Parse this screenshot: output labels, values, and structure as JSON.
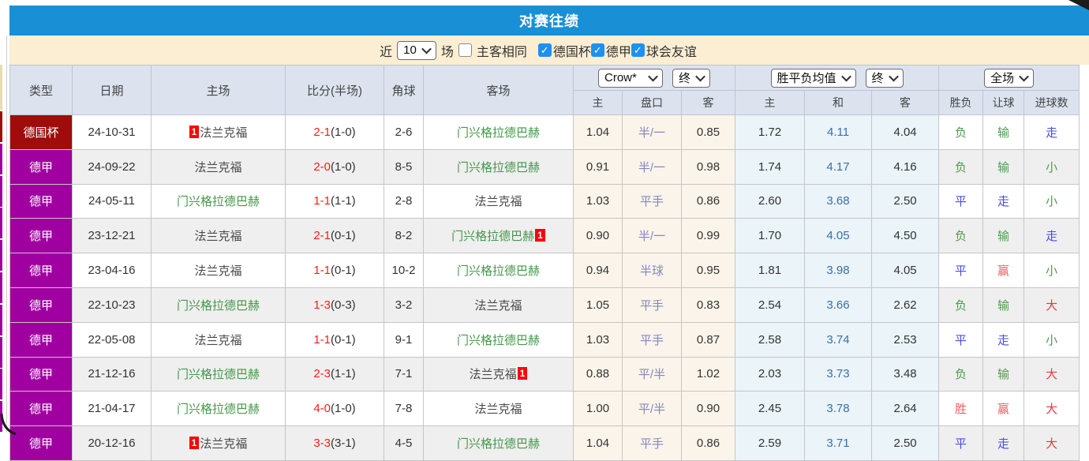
{
  "title": "对赛往绩",
  "filter": {
    "near_label": "近",
    "count_select": "10",
    "games_label": "场",
    "same_venue": {
      "checked": false,
      "label": "主客相同"
    },
    "competitions": [
      {
        "checked": true,
        "label": "德国杯"
      },
      {
        "checked": true,
        "label": "德甲"
      },
      {
        "checked": true,
        "label": "球会友谊"
      }
    ]
  },
  "header": {
    "col_type": "类型",
    "col_date": "日期",
    "col_home": "主场",
    "col_score": "比分(半场)",
    "col_corner": "角球",
    "col_away": "客场",
    "crow_select": "Crow*",
    "crow_final_select": "终",
    "wdl_select": "胜平负均值",
    "wdl_final_select": "终",
    "scope_select": "全场",
    "sub": {
      "home": "主",
      "handicap": "盘口",
      "away": "客",
      "avg_home": "主",
      "avg_draw": "和",
      "avg_away": "客",
      "result": "胜负",
      "handicap_result": "让球",
      "goals": "进球数"
    }
  },
  "colors": {
    "titlebar_blue": "#1990d5",
    "filterbar_cream": "#fbeed3",
    "header_cell": "#dce3ef",
    "cup_red": "#a00c0c",
    "league_purple": "#a100a1",
    "team_green": "#44984a",
    "score_red": "#ff1a1a",
    "handicap_slate": "#8585c6",
    "avg_draw_blue": "#3a6fa8",
    "result_green": "#4e9b4e",
    "result_blue": "#4a4aee",
    "result_red": "#e83a3a",
    "result_pink": "#f26060",
    "red_card_badge": "#ff0000",
    "odds_col_bg": "#faf4ea",
    "avg_col_bg": "#eaf4f9"
  },
  "rows": [
    {
      "type": "德国杯",
      "type_style": "t-cup",
      "date": "24-10-31",
      "home": {
        "name": "法兰克福",
        "green": false,
        "badge": "1",
        "badge_pos": "before"
      },
      "score": "2-1",
      "half": "(1-0)",
      "corner": "2-6",
      "away": {
        "name": "门兴格拉德巴赫",
        "green": true
      },
      "odds": [
        "1.04",
        "半/一",
        "0.85"
      ],
      "avg": [
        "1.72",
        "4.11",
        "4.04"
      ],
      "result": {
        "text": "负",
        "cls": "green"
      },
      "hresult": {
        "text": "输",
        "cls": "green"
      },
      "goals": {
        "text": "走",
        "cls": "blue"
      }
    },
    {
      "type": "德甲",
      "type_style": "t-league",
      "date": "24-09-22",
      "home": {
        "name": "法兰克福",
        "green": false
      },
      "score": "2-0",
      "half": "(1-0)",
      "corner": "8-5",
      "away": {
        "name": "门兴格拉德巴赫",
        "green": true
      },
      "odds": [
        "0.91",
        "半/一",
        "0.98"
      ],
      "avg": [
        "1.74",
        "4.17",
        "4.16"
      ],
      "result": {
        "text": "负",
        "cls": "green"
      },
      "hresult": {
        "text": "输",
        "cls": "green"
      },
      "goals": {
        "text": "小",
        "cls": "green"
      }
    },
    {
      "type": "德甲",
      "type_style": "t-league",
      "date": "24-05-11",
      "home": {
        "name": "门兴格拉德巴赫",
        "green": true
      },
      "score": "1-1",
      "half": "(1-1)",
      "corner": "2-8",
      "away": {
        "name": "法兰克福",
        "green": false
      },
      "odds": [
        "1.03",
        "平手",
        "0.86"
      ],
      "avg": [
        "2.60",
        "3.68",
        "2.50"
      ],
      "result": {
        "text": "平",
        "cls": "blue"
      },
      "hresult": {
        "text": "走",
        "cls": "blue"
      },
      "goals": {
        "text": "小",
        "cls": "green"
      }
    },
    {
      "type": "德甲",
      "type_style": "t-league",
      "date": "23-12-21",
      "home": {
        "name": "法兰克福",
        "green": false
      },
      "score": "2-1",
      "half": "(0-1)",
      "corner": "8-2",
      "away": {
        "name": "门兴格拉德巴赫",
        "green": true,
        "badge": "1",
        "badge_pos": "after"
      },
      "odds": [
        "0.90",
        "半/一",
        "0.99"
      ],
      "avg": [
        "1.70",
        "4.05",
        "4.50"
      ],
      "result": {
        "text": "负",
        "cls": "green"
      },
      "hresult": {
        "text": "输",
        "cls": "green"
      },
      "goals": {
        "text": "走",
        "cls": "blue"
      }
    },
    {
      "type": "德甲",
      "type_style": "t-league",
      "date": "23-04-16",
      "home": {
        "name": "法兰克福",
        "green": false
      },
      "score": "1-1",
      "half": "(0-1)",
      "corner": "10-2",
      "away": {
        "name": "门兴格拉德巴赫",
        "green": true
      },
      "odds": [
        "0.94",
        "半球",
        "0.95"
      ],
      "avg": [
        "1.81",
        "3.98",
        "4.05"
      ],
      "result": {
        "text": "平",
        "cls": "blue"
      },
      "hresult": {
        "text": "赢",
        "cls": "pink"
      },
      "goals": {
        "text": "小",
        "cls": "green"
      }
    },
    {
      "type": "德甲",
      "type_style": "t-league",
      "date": "22-10-23",
      "home": {
        "name": "门兴格拉德巴赫",
        "green": true
      },
      "score": "1-3",
      "half": "(0-3)",
      "corner": "3-2",
      "away": {
        "name": "法兰克福",
        "green": false
      },
      "odds": [
        "1.05",
        "平手",
        "0.83"
      ],
      "avg": [
        "2.54",
        "3.66",
        "2.62"
      ],
      "result": {
        "text": "负",
        "cls": "green"
      },
      "hresult": {
        "text": "输",
        "cls": "green"
      },
      "goals": {
        "text": "大",
        "cls": "red"
      }
    },
    {
      "type": "德甲",
      "type_style": "t-league",
      "date": "22-05-08",
      "home": {
        "name": "法兰克福",
        "green": false
      },
      "score": "1-1",
      "half": "(0-1)",
      "corner": "9-1",
      "away": {
        "name": "门兴格拉德巴赫",
        "green": true
      },
      "odds": [
        "1.03",
        "平手",
        "0.87"
      ],
      "avg": [
        "2.58",
        "3.74",
        "2.53"
      ],
      "result": {
        "text": "平",
        "cls": "blue"
      },
      "hresult": {
        "text": "走",
        "cls": "blue"
      },
      "goals": {
        "text": "小",
        "cls": "green"
      }
    },
    {
      "type": "德甲",
      "type_style": "t-league",
      "date": "21-12-16",
      "home": {
        "name": "门兴格拉德巴赫",
        "green": true
      },
      "score": "2-3",
      "half": "(1-1)",
      "corner": "7-1",
      "away": {
        "name": "法兰克福",
        "green": false,
        "badge": "1",
        "badge_pos": "after"
      },
      "odds": [
        "0.88",
        "平/半",
        "1.02"
      ],
      "avg": [
        "2.03",
        "3.73",
        "3.48"
      ],
      "result": {
        "text": "负",
        "cls": "green"
      },
      "hresult": {
        "text": "输",
        "cls": "green"
      },
      "goals": {
        "text": "大",
        "cls": "red"
      }
    },
    {
      "type": "德甲",
      "type_style": "t-league",
      "date": "21-04-17",
      "home": {
        "name": "门兴格拉德巴赫",
        "green": true
      },
      "score": "4-0",
      "half": "(1-0)",
      "corner": "7-8",
      "away": {
        "name": "法兰克福",
        "green": false
      },
      "odds": [
        "1.00",
        "平/半",
        "0.90"
      ],
      "avg": [
        "2.45",
        "3.78",
        "2.64"
      ],
      "result": {
        "text": "胜",
        "cls": "pink"
      },
      "hresult": {
        "text": "赢",
        "cls": "pink"
      },
      "goals": {
        "text": "大",
        "cls": "red"
      }
    },
    {
      "type": "德甲",
      "type_style": "t-league",
      "date": "20-12-16",
      "home": {
        "name": "法兰克福",
        "green": false,
        "badge": "1",
        "badge_pos": "before"
      },
      "score": "3-3",
      "half": "(3-1)",
      "corner": "4-5",
      "away": {
        "name": "门兴格拉德巴赫",
        "green": true
      },
      "odds": [
        "1.04",
        "平手",
        "0.86"
      ],
      "avg": [
        "2.59",
        "3.71",
        "2.50"
      ],
      "result": {
        "text": "平",
        "cls": "blue"
      },
      "hresult": {
        "text": "走",
        "cls": "blue"
      },
      "goals": {
        "text": "大",
        "cls": "red"
      }
    }
  ]
}
